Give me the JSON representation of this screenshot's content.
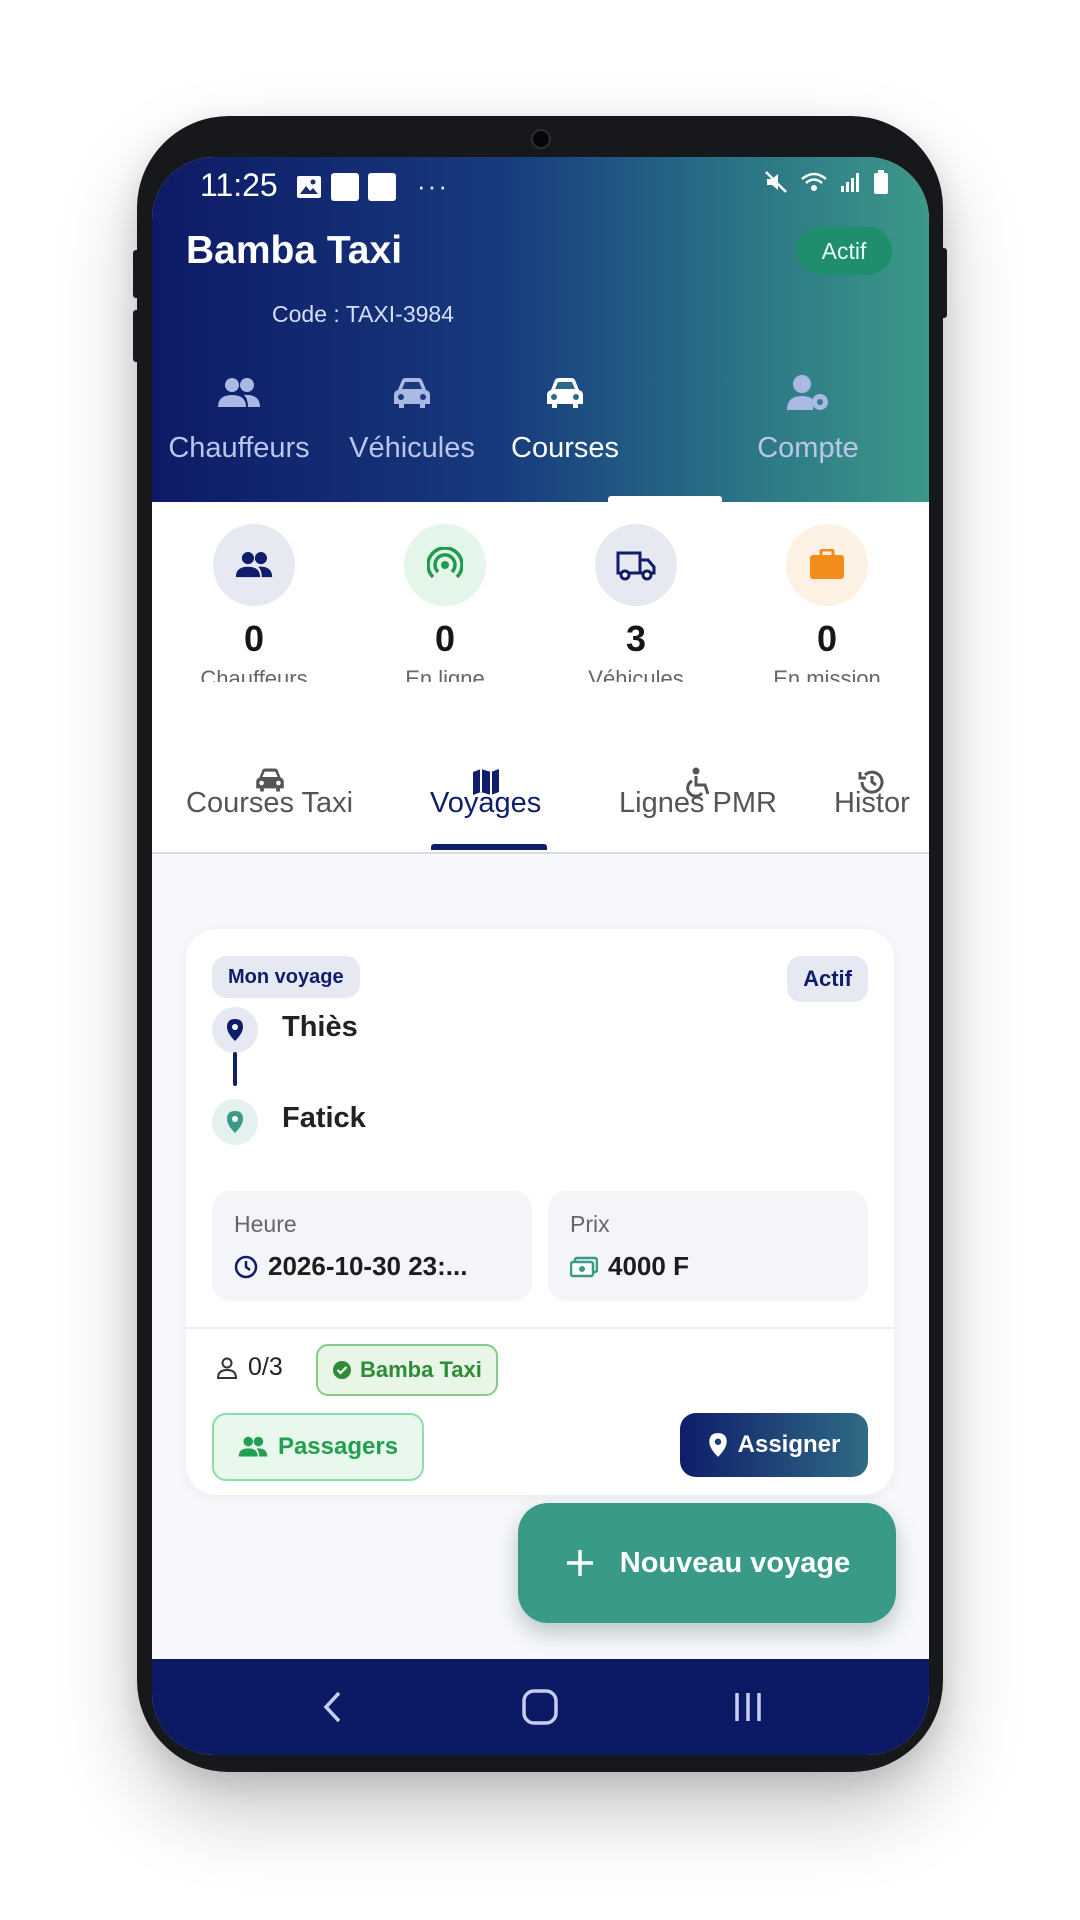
{
  "status_bar": {
    "time": "11:25",
    "dots": "···"
  },
  "header": {
    "title": "Bamba Taxi",
    "status_badge": "Actif",
    "code": "Code : TAXI-3984",
    "tabs": [
      {
        "label": "Chauffeurs",
        "icon": "people-icon"
      },
      {
        "label": "Véhicules",
        "icon": "car-icon"
      },
      {
        "label": "Courses",
        "icon": "car-icon",
        "active": true
      },
      {
        "label": "Compte",
        "icon": "user-gear-icon"
      }
    ]
  },
  "stats": [
    {
      "value": "0",
      "label": "Chauffeurs",
      "icon": "people-icon",
      "bg": "#e6e9f1",
      "color": "#0f1d6b"
    },
    {
      "value": "0",
      "label": "En ligne",
      "icon": "signal-icon",
      "bg": "#e4f5ea",
      "color": "#1f9a4e"
    },
    {
      "value": "3",
      "label": "Véhicules",
      "icon": "truck-icon",
      "bg": "#e6e9f1",
      "color": "#0f1d6b"
    },
    {
      "value": "0",
      "label": "En mission",
      "icon": "briefcase-icon",
      "bg": "#fdf1e3",
      "color": "#f28c1b"
    }
  ],
  "subtabs": [
    {
      "label": "Courses Taxi",
      "icon": "car-icon"
    },
    {
      "label": "Voyages",
      "icon": "map-icon",
      "active": true
    },
    {
      "label": "Lignes PMR",
      "icon": "wheelchair-icon"
    },
    {
      "label": "Histor",
      "icon": "history-icon"
    }
  ],
  "trip": {
    "tag": "Mon voyage",
    "status": "Actif",
    "from": "Thiès",
    "to": "Fatick",
    "time_label": "Heure",
    "time_value": "2026-10-30 23:...",
    "price_label": "Prix",
    "price_value": "4000 F",
    "seats": "0/3",
    "driver": "Bamba Taxi",
    "passengers_btn": "Passagers",
    "assign_btn": "Assigner"
  },
  "fab": {
    "label": "Nouveau voyage"
  },
  "colors": {
    "navy": "#0f1d6b",
    "teal": "#3a9a88",
    "green": "#21a04f",
    "orange": "#f28c1b"
  }
}
